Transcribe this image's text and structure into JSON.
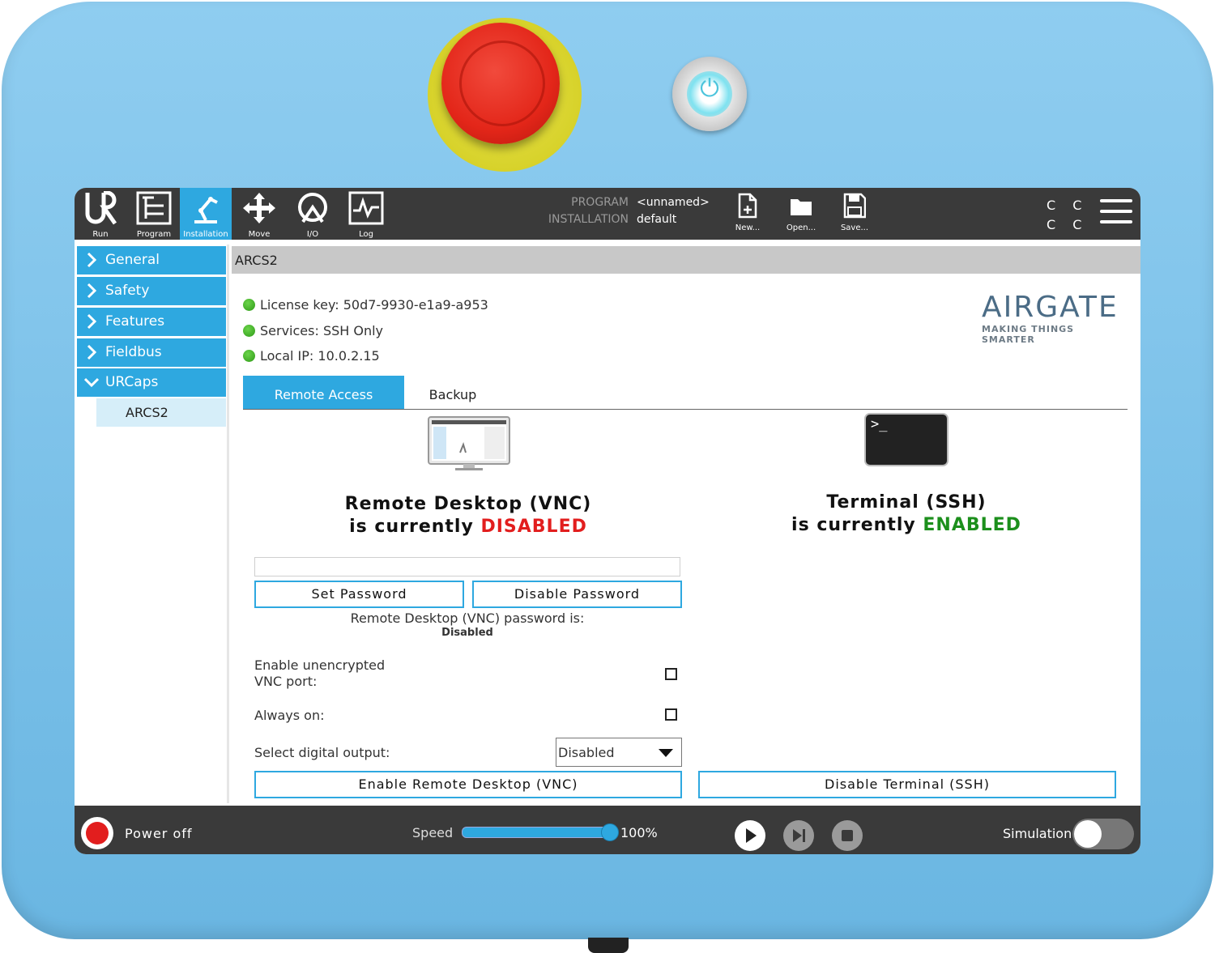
{
  "topbar": {
    "nav": [
      {
        "label": "Run",
        "icon": "ur-logo-icon"
      },
      {
        "label": "Program",
        "icon": "program-tree-icon"
      },
      {
        "label": "Installation",
        "icon": "robot-arm-icon"
      },
      {
        "label": "Move",
        "icon": "move-arrows-icon"
      },
      {
        "label": "I/O",
        "icon": "io-icon"
      },
      {
        "label": "Log",
        "icon": "log-chart-icon"
      }
    ],
    "active_nav": "Installation",
    "program_key": "PROGRAM",
    "program_value": "<unnamed>",
    "installation_key": "INSTALLATION",
    "installation_value": "default",
    "new_label": "New...",
    "open_label": "Open...",
    "save_label": "Save...",
    "cc_top": "C C",
    "cc_bottom": "C C"
  },
  "sidebar": {
    "items": [
      {
        "label": "General"
      },
      {
        "label": "Safety"
      },
      {
        "label": "Features"
      },
      {
        "label": "Fieldbus"
      },
      {
        "label": "URCaps"
      }
    ],
    "sub_item": "ARCS2"
  },
  "main": {
    "title": "ARCS2",
    "status": {
      "license": "License key: 50d7-9930-e1a9-a953",
      "services": "Services: SSH Only",
      "ip": "Local IP: 10.0.2.15"
    },
    "logo": {
      "word": "AIRGATE",
      "tagline": "MAKING THINGS SMARTER"
    },
    "tabs": [
      {
        "label": "Remote Access"
      },
      {
        "label": "Backup"
      }
    ],
    "vnc": {
      "heading_line1": "Remote Desktop (VNC)",
      "heading_prefix": "is currently ",
      "state": "DISABLED",
      "password_value": "",
      "set_password_label": "Set Password",
      "disable_password_label": "Disable Password",
      "password_status_text": "Remote Desktop (VNC) password is:",
      "password_status_value": "Disabled",
      "unencrypted_label_line1": "Enable unencrypted",
      "unencrypted_label_line2": "VNC port:",
      "always_on_label": "Always on:",
      "digital_output_label": "Select digital output:",
      "digital_output_selected": "Disabled",
      "enable_button_label": "Enable Remote Desktop (VNC)"
    },
    "ssh": {
      "heading_line1": "Terminal (SSH)",
      "heading_prefix": "is currently ",
      "state": "ENABLED",
      "prompt": ">_",
      "disable_button_label": "Disable Terminal (SSH)"
    }
  },
  "bottombar": {
    "power_label": "Power off",
    "speed_label": "Speed",
    "speed_value": "100%",
    "speed_fraction": 1.0,
    "simulation_label": "Simulation",
    "simulation_on": false
  },
  "colors": {
    "accent": "#2ea8e0",
    "disabled_red": "#e21e1e",
    "enabled_green": "#1c8f1c",
    "bar_dark": "#3a3a3a"
  }
}
